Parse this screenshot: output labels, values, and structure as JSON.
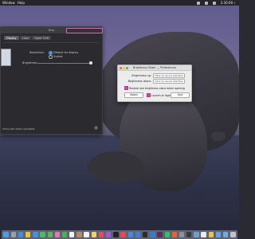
{
  "menubar": {
    "items": [
      "Window",
      "Help"
    ],
    "clock": "2:30:00 ☾"
  },
  "prefs_window": {
    "title": "Disp",
    "tabs": [
      "Display",
      "Color",
      "Night Shift"
    ],
    "resolution_label": "Resolution:",
    "resolution_options": [
      "Default for display",
      "Scaled"
    ],
    "brightness_label": "Brightness:",
    "footer_text": "menu bar when available",
    "help": "?"
  },
  "brightness_window": {
    "title": "Brightness Slider — Preferences",
    "brightness_up_label": "Brightness up:",
    "brightness_down_label": "Brightness down:",
    "record_shortcut_label": "Click to record shortcut",
    "restore_label": "Restore last brightness value when opening",
    "about_label": "About",
    "launch_label": "Launch at login",
    "quit_label": "Quit",
    "checkbox_color": "#d04aa4"
  },
  "dock": {
    "icons": [
      {
        "name": "finder-icon",
        "color": "#4a9be8"
      },
      {
        "name": "launchpad-icon",
        "color": "#9aa0a8"
      },
      {
        "name": "safari-icon",
        "color": "#3c8fe0"
      },
      {
        "name": "chrome-icon",
        "color": "#e9c23a"
      },
      {
        "name": "mail-icon",
        "color": "#4b8fe0"
      },
      {
        "name": "messages-icon",
        "color": "#3ec45a"
      },
      {
        "name": "maps-icon",
        "color": "#5bb85a"
      },
      {
        "name": "photos-icon",
        "color": "#e07bb0"
      },
      {
        "name": "facetime-icon",
        "color": "#40b84e"
      },
      {
        "name": "calendar-icon",
        "color": "#f2f2f2"
      },
      {
        "name": "contacts-icon",
        "color": "#b58b60"
      },
      {
        "name": "reminders-icon",
        "color": "#f0f0f0"
      },
      {
        "name": "notes-icon",
        "color": "#f4d55a"
      },
      {
        "name": "music-icon",
        "color": "#f0475b"
      },
      {
        "name": "podcasts-icon",
        "color": "#9b5bd6"
      },
      {
        "name": "tv-icon",
        "color": "#222226"
      },
      {
        "name": "news-icon",
        "color": "#f04452"
      },
      {
        "name": "appstore-icon",
        "color": "#3a8ee6"
      },
      {
        "name": "xcode-icon",
        "color": "#3d7ee0"
      },
      {
        "name": "terminal-icon",
        "color": "#2b2b2b"
      },
      {
        "name": "vscode-icon",
        "color": "#2f7fd0"
      },
      {
        "name": "slack-icon",
        "color": "#5a2d5e"
      },
      {
        "name": "spotify-icon",
        "color": "#2ec35c"
      },
      {
        "name": "firefox-icon",
        "color": "#e6632b"
      },
      {
        "name": "preferences-icon",
        "color": "#8d9098"
      },
      {
        "name": "activity-icon",
        "color": "#3a3a3a"
      },
      {
        "name": "preview-icon",
        "color": "#6aa0d8"
      },
      {
        "name": "textedit-icon",
        "color": "#eaeaea"
      },
      {
        "name": "brightness-icon",
        "color": "#f0c040"
      },
      {
        "name": "folder-icon",
        "color": "#5aa6e6"
      },
      {
        "name": "downloads-icon",
        "color": "#6aaee8"
      },
      {
        "name": "trash-icon",
        "color": "#bfc3c8"
      }
    ]
  }
}
